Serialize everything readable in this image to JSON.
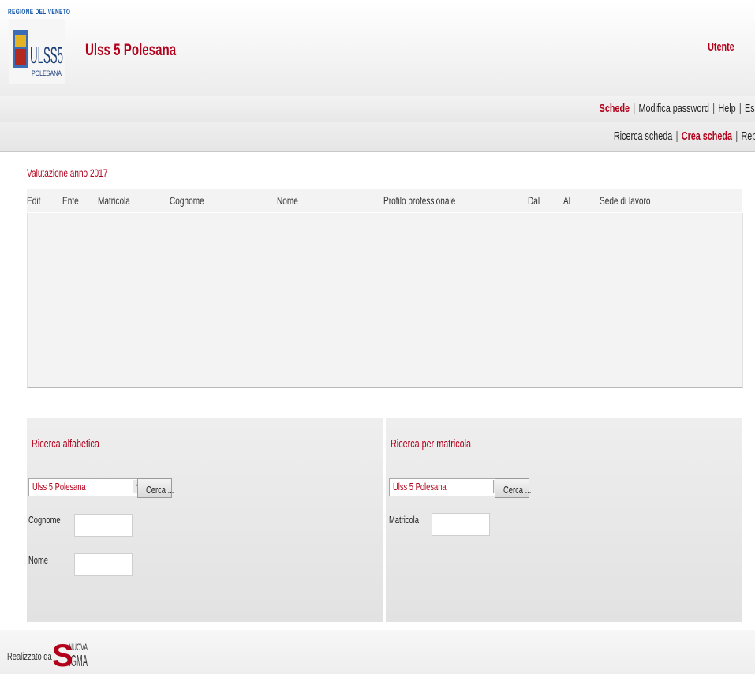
{
  "header": {
    "region_label": "REGIONE DEL VENETO",
    "app_title": "Ulss 5 Polesana",
    "user_link": "Utente",
    "logo_text": "ULSS5",
    "logo_subtext": "POLESANA"
  },
  "nav_main": [
    {
      "label": "Schede",
      "active": true
    },
    {
      "label": "Modifica password",
      "active": false
    },
    {
      "label": "Help",
      "active": false
    },
    {
      "label": "Es",
      "active": false
    }
  ],
  "nav_sub": [
    {
      "label": "Ricerca scheda",
      "active": false
    },
    {
      "label": "Crea scheda",
      "active": true
    },
    {
      "label": "Repo",
      "active": false
    }
  ],
  "results": {
    "title": "Valutazione anno 2017",
    "columns": [
      "Edit",
      "Ente",
      "Matricola",
      "Cognome",
      "Nome",
      "Profilo professionale",
      "Dal",
      "Al",
      "Sede di lavoro"
    ],
    "rows": []
  },
  "search_alpha": {
    "legend": "Ricerca alfabetica",
    "ente_selected": "Ulss 5 Polesana",
    "button": "Cerca ...",
    "cognome_label": "Cognome",
    "cognome_value": "",
    "nome_label": "Nome",
    "nome_value": ""
  },
  "search_matricola": {
    "legend": "Ricerca per matricola",
    "ente_selected": "Ulss 5 Polesana",
    "button": "Cerca ...",
    "matricola_label": "Matricola",
    "matricola_value": ""
  },
  "footer": {
    "text": "Realizzato da",
    "brand_top": "NUOVA",
    "brand_bottom": "SIGMA"
  },
  "colors": {
    "accent": "#b3001b",
    "panel": "#e6e6e6",
    "nav": "#ececec"
  }
}
